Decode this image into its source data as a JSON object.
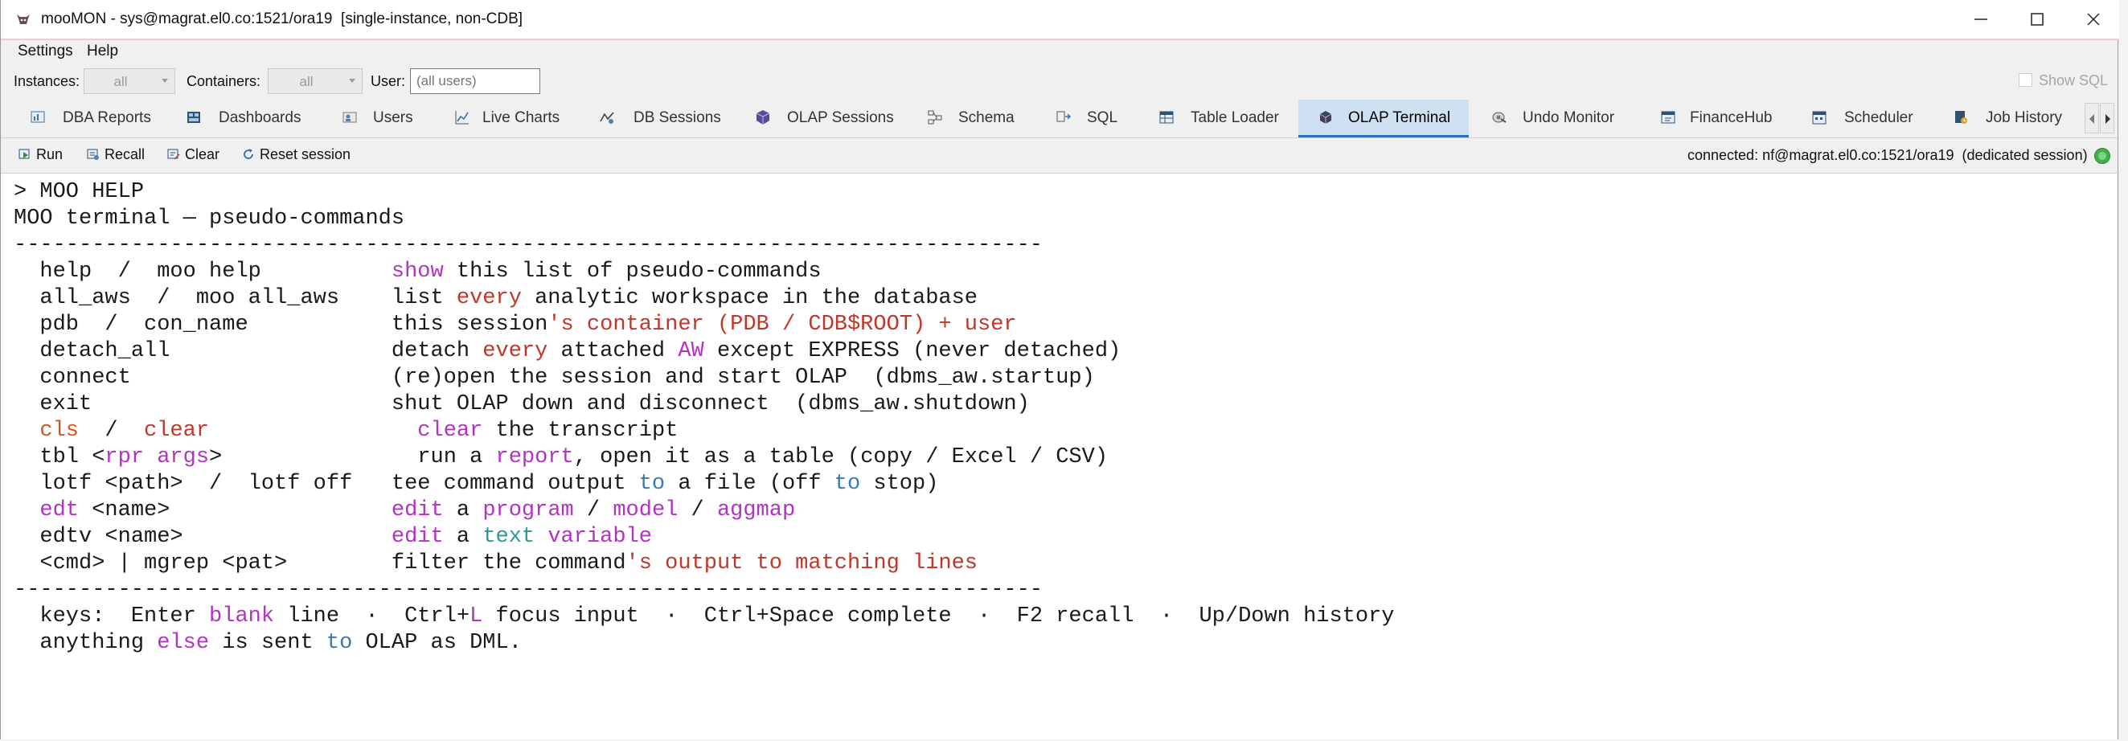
{
  "window": {
    "title": "mooMON - sys@magrat.el0.co:1521/ora19  [single-instance, non-CDB]"
  },
  "menu": {
    "items": [
      "Settings",
      "Help"
    ]
  },
  "filters": {
    "instances_label": "Instances:",
    "instances_value": "all",
    "containers_label": "Containers:",
    "containers_value": "all",
    "user_label": "User:",
    "user_placeholder": "(all users)",
    "show_sql_label": "Show SQL"
  },
  "tabs": [
    {
      "label": "DBA Reports",
      "icon": "reports-icon"
    },
    {
      "label": "Dashboards",
      "icon": "dashboard-icon"
    },
    {
      "label": "Users",
      "icon": "users-icon"
    },
    {
      "label": "Live Charts",
      "icon": "chart-icon"
    },
    {
      "label": "DB Sessions",
      "icon": "sessions-icon"
    },
    {
      "label": "OLAP Sessions",
      "icon": "cube-icon"
    },
    {
      "label": "Schema",
      "icon": "schema-icon"
    },
    {
      "label": "SQL",
      "icon": "sql-icon"
    },
    {
      "label": "Table Loader",
      "icon": "table-icon"
    },
    {
      "label": "OLAP Terminal",
      "icon": "terminal-icon",
      "active": true
    },
    {
      "label": "Undo Monitor",
      "icon": "undo-icon"
    },
    {
      "label": "FinanceHub",
      "icon": "finance-icon"
    },
    {
      "label": "Scheduler",
      "icon": "calendar-icon"
    },
    {
      "label": "Job History",
      "icon": "job-icon"
    }
  ],
  "toolbar": {
    "run_label": "Run",
    "recall_label": "Recall",
    "clear_label": "Clear",
    "reset_label": "Reset session",
    "connection_status": "connected: nf@magrat.el0.co:1521/ora19  (dedicated session)"
  },
  "colors": {
    "magenta": "#b232c2",
    "red": "#c0372a",
    "blue": "#3a78b6",
    "teal": "#2a9a96",
    "orange": "#d0561e",
    "active_tab": "#cfe0f2",
    "status_ok": "#3fb04b"
  },
  "terminal": {
    "lines": [
      [
        {
          "t": "> MOO HELP"
        }
      ],
      [
        {
          "t": "MOO terminal — pseudo-commands"
        }
      ],
      [
        {
          "t": "-------------------------------------------------------------------------------"
        }
      ],
      [
        {
          "t": "  help  /  moo help          "
        },
        {
          "t": "show",
          "c": "magenta"
        },
        {
          "t": " this list of pseudo-commands"
        }
      ],
      [
        {
          "t": "  all_aws  /  moo all_aws    list "
        },
        {
          "t": "every",
          "c": "red"
        },
        {
          "t": " analytic workspace in the database"
        }
      ],
      [
        {
          "t": "  pdb  /  con_name           this session"
        },
        {
          "t": "'s container (PDB / CDB$ROOT) + user",
          "c": "red"
        }
      ],
      [
        {
          "t": "  detach_all                 detach "
        },
        {
          "t": "every",
          "c": "red"
        },
        {
          "t": " attached "
        },
        {
          "t": "AW",
          "c": "magenta"
        },
        {
          "t": " except EXPRESS (never detached)"
        }
      ],
      [
        {
          "t": "  connect                    (re)open the session and start OLAP  (dbms_aw.startup)"
        }
      ],
      [
        {
          "t": "  exit                       shut OLAP down and disconnect  (dbms_aw.shutdown)"
        }
      ],
      [
        {
          "t": "  "
        },
        {
          "t": "cls",
          "c": "orange"
        },
        {
          "t": "  /  "
        },
        {
          "t": "clear",
          "c": "red"
        },
        {
          "t": "                "
        },
        {
          "t": "clear",
          "c": "magenta"
        },
        {
          "t": " the transcript"
        }
      ],
      [
        {
          "t": "  tbl <"
        },
        {
          "t": "rpr args",
          "c": "magenta"
        },
        {
          "t": ">               run a "
        },
        {
          "t": "report",
          "c": "magenta"
        },
        {
          "t": ", open it as a table (copy / Excel / CSV)"
        }
      ],
      [
        {
          "t": "  lotf <path>  /  lotf off   tee command output "
        },
        {
          "t": "to",
          "c": "blue"
        },
        {
          "t": " a file (off "
        },
        {
          "t": "to",
          "c": "blue"
        },
        {
          "t": " stop)"
        }
      ],
      [
        {
          "t": "  "
        },
        {
          "t": "edt",
          "c": "magenta"
        },
        {
          "t": " <name>                 "
        },
        {
          "t": "edit",
          "c": "magenta"
        },
        {
          "t": " a "
        },
        {
          "t": "program",
          "c": "magenta"
        },
        {
          "t": " / "
        },
        {
          "t": "model",
          "c": "magenta"
        },
        {
          "t": " / "
        },
        {
          "t": "aggmap",
          "c": "magenta"
        }
      ],
      [
        {
          "t": "  edtv <name>                "
        },
        {
          "t": "edit",
          "c": "magenta"
        },
        {
          "t": " a "
        },
        {
          "t": "text",
          "c": "teal"
        },
        {
          "t": " "
        },
        {
          "t": "variable",
          "c": "magenta"
        }
      ],
      [
        {
          "t": "  <cmd> | mgrep <pat>        filter the command"
        },
        {
          "t": "'s output to matching lines",
          "c": "red"
        }
      ],
      [
        {
          "t": "-------------------------------------------------------------------------------"
        }
      ],
      [
        {
          "t": "  keys:  Enter "
        },
        {
          "t": "blank",
          "c": "magenta"
        },
        {
          "t": " line  ·  Ctrl+"
        },
        {
          "t": "L",
          "c": "magenta"
        },
        {
          "t": " focus input  ·  Ctrl+Space complete  ·  F2 recall  ·  Up/Down history"
        }
      ],
      [
        {
          "t": "  anything "
        },
        {
          "t": "else",
          "c": "magenta"
        },
        {
          "t": " is sent "
        },
        {
          "t": "to",
          "c": "blue"
        },
        {
          "t": " OLAP as DML."
        }
      ]
    ]
  }
}
